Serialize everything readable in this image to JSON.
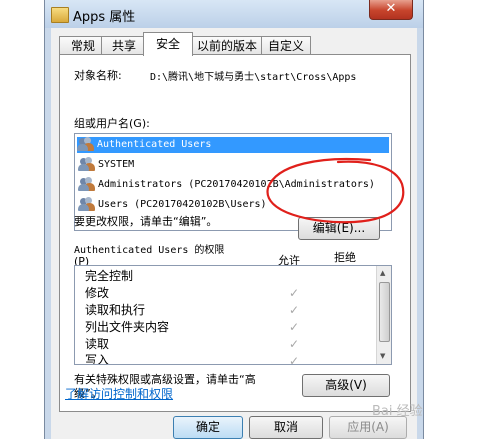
{
  "window": {
    "title": "Apps 属性",
    "close_glyph": "✕"
  },
  "tabs": [
    {
      "label": "常规",
      "active": false
    },
    {
      "label": "共享",
      "active": false
    },
    {
      "label": "安全",
      "active": true
    },
    {
      "label": "以前的版本",
      "active": false
    },
    {
      "label": "自定义",
      "active": false
    }
  ],
  "object_name": {
    "label": "对象名称:",
    "value": "D:\\腾讯\\地下城与勇士\\start\\Cross\\Apps"
  },
  "groups": {
    "label": "组或用户名(G):",
    "items": [
      {
        "name": "Authenticated Users",
        "selected": true
      },
      {
        "name": "SYSTEM",
        "selected": false
      },
      {
        "name": "Administrators (PC20170420102B\\Administrators)",
        "selected": false
      },
      {
        "name": "Users (PC20170420102B\\Users)",
        "selected": false
      }
    ]
  },
  "change_hint": "要更改权限，请单击“编辑”。",
  "edit_button": "编辑(E)...",
  "permissions": {
    "label_line1": "Authenticated Users 的权限",
    "label_line2": "(P)",
    "allow_header": "允许",
    "deny_header": "拒绝",
    "rows": [
      {
        "name": "完全控制",
        "allow": false
      },
      {
        "name": "修改",
        "allow": true
      },
      {
        "name": "读取和执行",
        "allow": true
      },
      {
        "name": "列出文件夹内容",
        "allow": true
      },
      {
        "name": "读取",
        "allow": true
      },
      {
        "name": "写入",
        "allow": true
      }
    ],
    "check_glyph": "✓"
  },
  "advanced": {
    "hint_line1": "有关特殊权限或高级设置，请单击“高",
    "hint_line2": "级”。",
    "button": "高级(V)"
  },
  "help_link": "了解访问控制和权限",
  "footer": {
    "ok": "确定",
    "cancel": "取消",
    "apply": "应用(A)"
  },
  "watermark": "Bai 经验",
  "colors": {
    "selection": "#3399ff",
    "annotation": "#e0201b",
    "link": "#0066cc"
  }
}
